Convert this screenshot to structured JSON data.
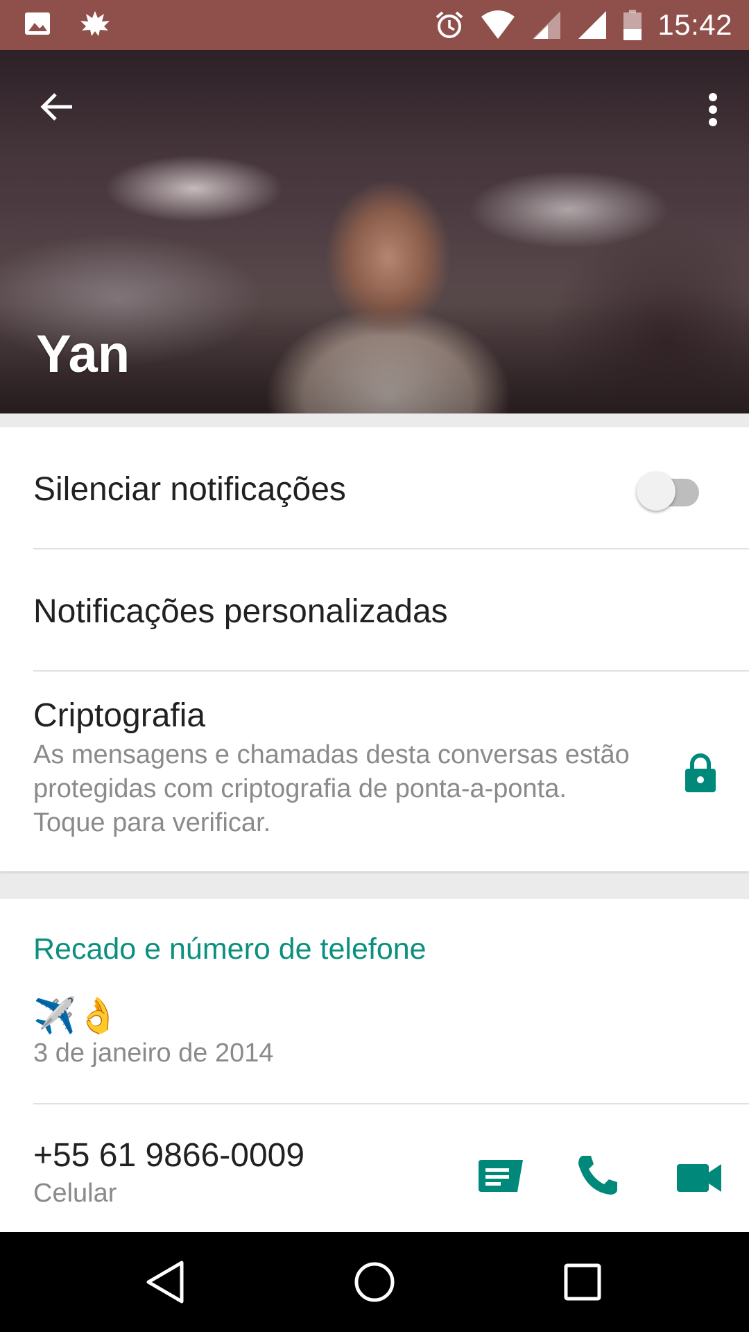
{
  "status_bar": {
    "time": "15:42",
    "icons": [
      "image-icon",
      "leaf-icon",
      "alarm-icon",
      "wifi-icon",
      "signal-icon",
      "signal-icon",
      "battery-icon"
    ]
  },
  "header": {
    "contact_name": "Yan",
    "back_icon": "arrow-back-icon",
    "menu_icon": "more-vert-icon"
  },
  "settings": {
    "mute": {
      "label": "Silenciar notificações",
      "enabled": false
    },
    "custom_notifications": {
      "label": "Notificações personalizadas"
    },
    "encryption": {
      "title": "Criptografia",
      "description": "As mensagens e chamadas desta conversas estão protegidas com criptografia de ponta-a-ponta. Toque para verificar.",
      "icon": "lock-icon"
    }
  },
  "about": {
    "section_title": "Recado e número de telefone",
    "status_text": "✈️👌",
    "status_date": "3 de janeiro de 2014",
    "phone_number": "+55 61 9866-0009",
    "phone_type": "Celular",
    "actions": [
      "message-icon",
      "call-icon",
      "videocam-icon"
    ]
  },
  "colors": {
    "status_bar": "#8f4f4a",
    "accent": "#0b8f7f",
    "icon_green": "#00897b",
    "nav_bar": "#000000"
  },
  "nav_bar": [
    "back-nav-icon",
    "home-nav-icon",
    "recents-nav-icon"
  ]
}
